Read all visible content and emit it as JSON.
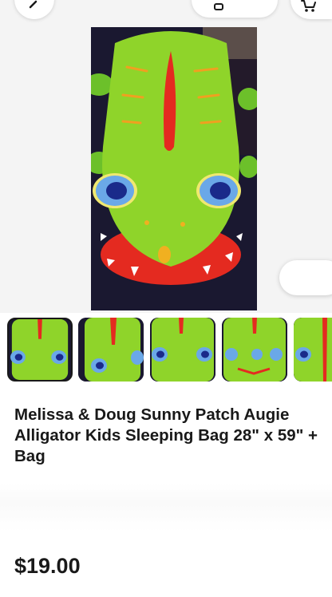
{
  "listing": {
    "title": "Melissa & Doug Sunny Patch Augie Alligator Kids Sleeping Bag 28\" x 59\" + Bag",
    "price": "$19.00"
  },
  "icons": {
    "back": "chevron-left-icon",
    "cart": "cart-icon",
    "share": "share-icon"
  },
  "gallery": {
    "thumbnail_count_visible": 5,
    "selected_index": 0
  },
  "colors": {
    "text": "#191919",
    "background": "#ffffff",
    "product_green": "#8fd42a",
    "product_red": "#e42a20"
  }
}
